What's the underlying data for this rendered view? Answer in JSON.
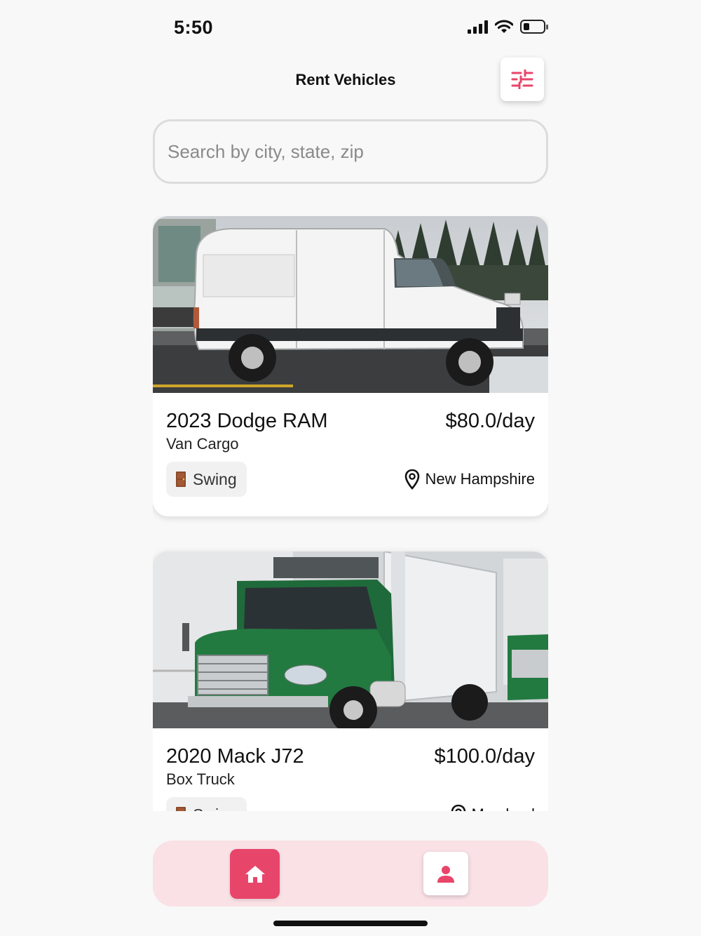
{
  "status_bar": {
    "time": "5:50"
  },
  "header": {
    "title": "Rent Vehicles"
  },
  "search": {
    "placeholder": "Search by city, state, zip",
    "value": ""
  },
  "colors": {
    "accent": "#e8456a",
    "nav_background": "#f9e1e6",
    "badge_background": "#f1f1f1"
  },
  "icons": {
    "filter": "sliders-icon",
    "door": "door-icon",
    "location": "location-pin-icon",
    "home": "home-icon",
    "profile": "person-icon"
  },
  "vehicles": [
    {
      "title": "2023 Dodge RAM",
      "type": "Van Cargo",
      "price": "$80.0/day",
      "door": "Swing",
      "location": "New Hampshire",
      "image": "white cargo van"
    },
    {
      "title": "2020 Mack J72",
      "type": "Box Truck",
      "price": "$100.0/day",
      "door": "Swing",
      "location": "Maryland",
      "image": "green box truck"
    }
  ]
}
